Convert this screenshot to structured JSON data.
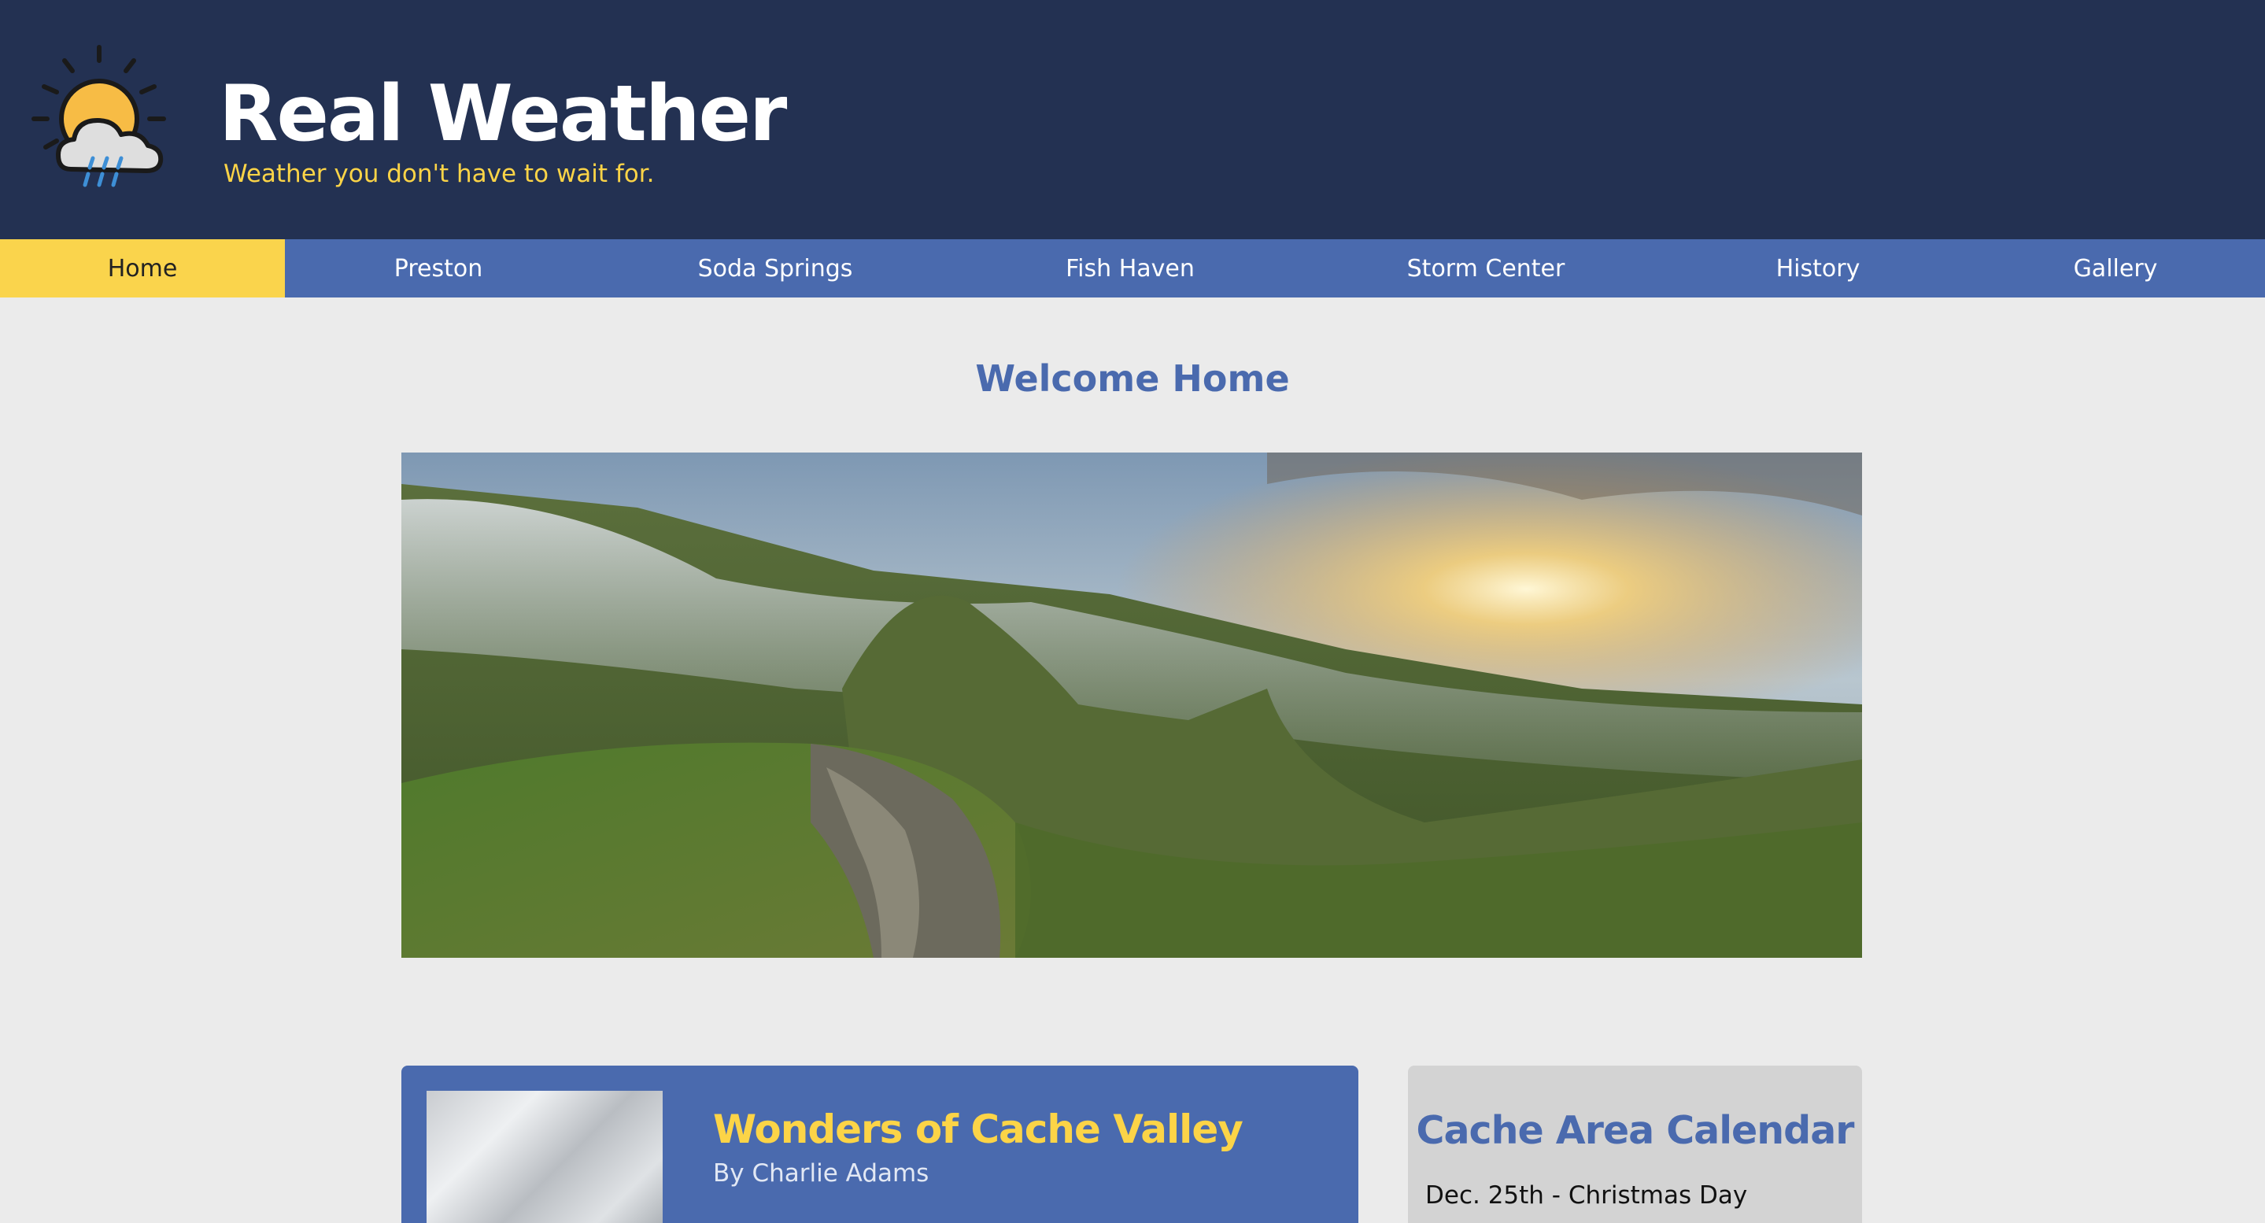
{
  "header": {
    "logo_icon": "sun-cloud-rain-icon",
    "title": "Real Weather",
    "tagline": "Weather you don't have to wait for."
  },
  "nav": {
    "items": [
      {
        "label": "Home",
        "active": true
      },
      {
        "label": "Preston",
        "active": false
      },
      {
        "label": "Soda Springs",
        "active": false
      },
      {
        "label": "Fish Haven",
        "active": false
      },
      {
        "label": "Storm Center",
        "active": false
      },
      {
        "label": "History",
        "active": false
      },
      {
        "label": "Gallery",
        "active": false
      }
    ]
  },
  "main": {
    "heading": "Welcome Home",
    "article": {
      "title": "Wonders of Cache Valley",
      "byline": "By Charlie Adams"
    },
    "calendar": {
      "title": "Cache Area Calendar",
      "items": [
        "Dec. 25th - Christmas Day"
      ]
    }
  },
  "colors": {
    "header_bg": "#233152",
    "nav_bg": "#4a6aae",
    "nav_active_bg": "#fad44c",
    "accent_yellow": "#fcd447",
    "heading_blue": "#4a6aae",
    "page_bg": "#ebebeb",
    "calendar_bg": "#d3d3d3"
  }
}
